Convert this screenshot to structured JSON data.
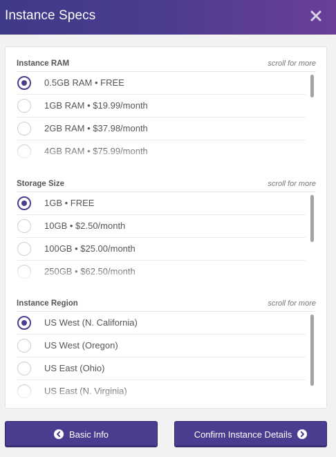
{
  "dialog": {
    "title": "Instance Specs",
    "close_icon": "close-icon"
  },
  "sections": [
    {
      "title": "Instance RAM",
      "hint": "scroll for more",
      "selected": 0,
      "options": [
        "0.5GB RAM • FREE",
        "1GB RAM • $19.99/month",
        "2GB RAM • $37.98/month",
        "4GB RAM • $75.99/month"
      ]
    },
    {
      "title": "Storage Size",
      "hint": "scroll for more",
      "selected": 0,
      "options": [
        "1GB • FREE",
        "10GB • $2.50/month",
        "100GB • $25.00/month",
        "250GB • $62.50/month"
      ]
    },
    {
      "title": "Instance Region",
      "hint": "scroll for more",
      "selected": 0,
      "options": [
        "US West (N. California)",
        "US West (Oregon)",
        "US East (Ohio)",
        "US East (N. Virginia)"
      ]
    }
  ],
  "buttons": {
    "back_label": "Basic Info",
    "confirm_label": "Confirm Instance Details"
  },
  "colors": {
    "accent": "#4a3d8f",
    "header_start": "#3f3a88",
    "header_end": "#6a3f99"
  }
}
